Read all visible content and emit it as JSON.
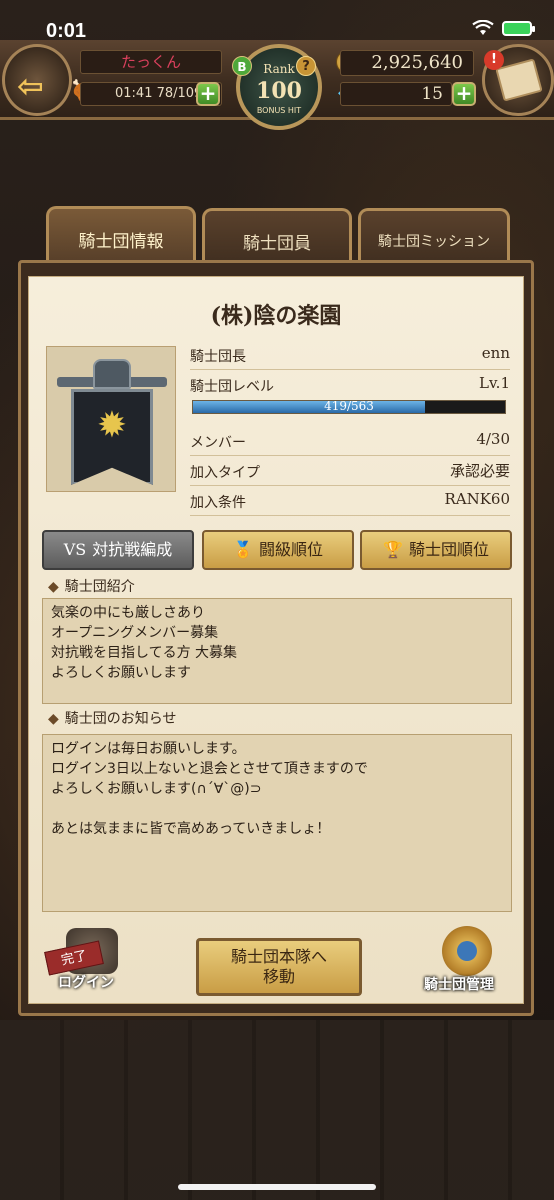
{
  "status_bar": {
    "time": "0:01"
  },
  "header": {
    "player_name": "たっくん",
    "stamina": "01:41 78/109",
    "rank_label": "Rank",
    "rank_value": "100",
    "rank_sub": "BONUS HIT",
    "b_badge": "B",
    "gold": "2,925,640",
    "gems": "15",
    "mail_alert": "!"
  },
  "tabs": [
    {
      "label": "騎士団情報",
      "active": true
    },
    {
      "label": "騎士団員",
      "active": false
    },
    {
      "label": "騎士団ミッション",
      "active": false
    }
  ],
  "order": {
    "name": "(株)陰の楽園",
    "leader_label": "騎士団長",
    "leader_value": "enn",
    "level_label": "騎士団レベル",
    "level_value": "Lv.1",
    "exp_text": "419/563",
    "exp_fraction": 0.744,
    "members_label": "メンバー",
    "members_value": "4/30",
    "join_type_label": "加入タイプ",
    "join_type_value": "承認必要",
    "join_condition_label": "加入条件",
    "join_condition_value": "RANK60"
  },
  "actions": {
    "battle_formation": "対抗戦編成",
    "fight_rank": "闘級順位",
    "order_rank": "騎士団順位"
  },
  "intro": {
    "title": "騎士団紹介",
    "lines": [
      "気楽の中にも厳しさあり",
      "オープニングメンバー募集",
      "対抗戦を目指してる方 大募集",
      "よろしくお願いします"
    ]
  },
  "notice": {
    "title": "騎士団のお知らせ",
    "lines": [
      "ログインは毎日お願いします。",
      "ログイン3日以上ないと退会とさせて頂きますので",
      "よろしくお願いします(∩´∀`@)⊃",
      "",
      "あとは気ままに皆で高めあっていきましょ！"
    ]
  },
  "footer": {
    "login_stamp": "完了",
    "login_label": "ログイン",
    "move_line1": "騎士団本隊へ",
    "move_line2": "移動",
    "manage_label": "騎士団管理"
  }
}
